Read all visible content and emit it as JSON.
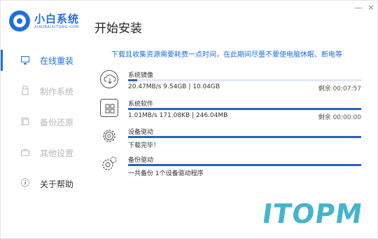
{
  "app": {
    "logo_name": "小白系统",
    "logo_sub": "XIAOBAIXITONG.COM",
    "page_title": "开始安装",
    "minimize_glyph": "—",
    "close_glyph": "✕",
    "accent_color": "#1f6fe0"
  },
  "sidebar": {
    "items": [
      {
        "label": "在线重装",
        "icon": "monitor-icon",
        "state": "active"
      },
      {
        "label": "制作系统",
        "icon": "usb-icon",
        "state": "disabled"
      },
      {
        "label": "备份还原",
        "icon": "backup-icon",
        "state": "disabled"
      },
      {
        "label": "其他设置",
        "icon": "toolbox-icon",
        "state": "disabled"
      },
      {
        "label": "关于帮助",
        "icon": "info-icon",
        "glyph": "ⓘ",
        "state": "normal"
      }
    ]
  },
  "notice": "下载且收集资源需要耗费一点时间，在此期间尽量不要使电脑休眠、断电等",
  "tasks": [
    {
      "name": "系统镜像",
      "detail": "20.47MB/s 9.54GB | 10.04GB",
      "remaining": "剩余 00:07:57",
      "progress": 0.04,
      "icon": "cloud-download-icon"
    },
    {
      "name": "系统软件",
      "detail": "1.01MB/s 171.08KB | 246.04MB",
      "remaining": "剩余 00:00:00",
      "progress": 1.0,
      "icon": "apps-icon"
    },
    {
      "name": "设备驱动",
      "detail": "下载完毕！",
      "remaining": "",
      "progress": 1.0,
      "icon": "gear-icon"
    },
    {
      "name": "备份驱动",
      "detail": "一共备份 1个设备驱动程序",
      "remaining": "",
      "progress": 1.0,
      "icon": "gears-icon"
    }
  ],
  "watermark": "ITOPM"
}
